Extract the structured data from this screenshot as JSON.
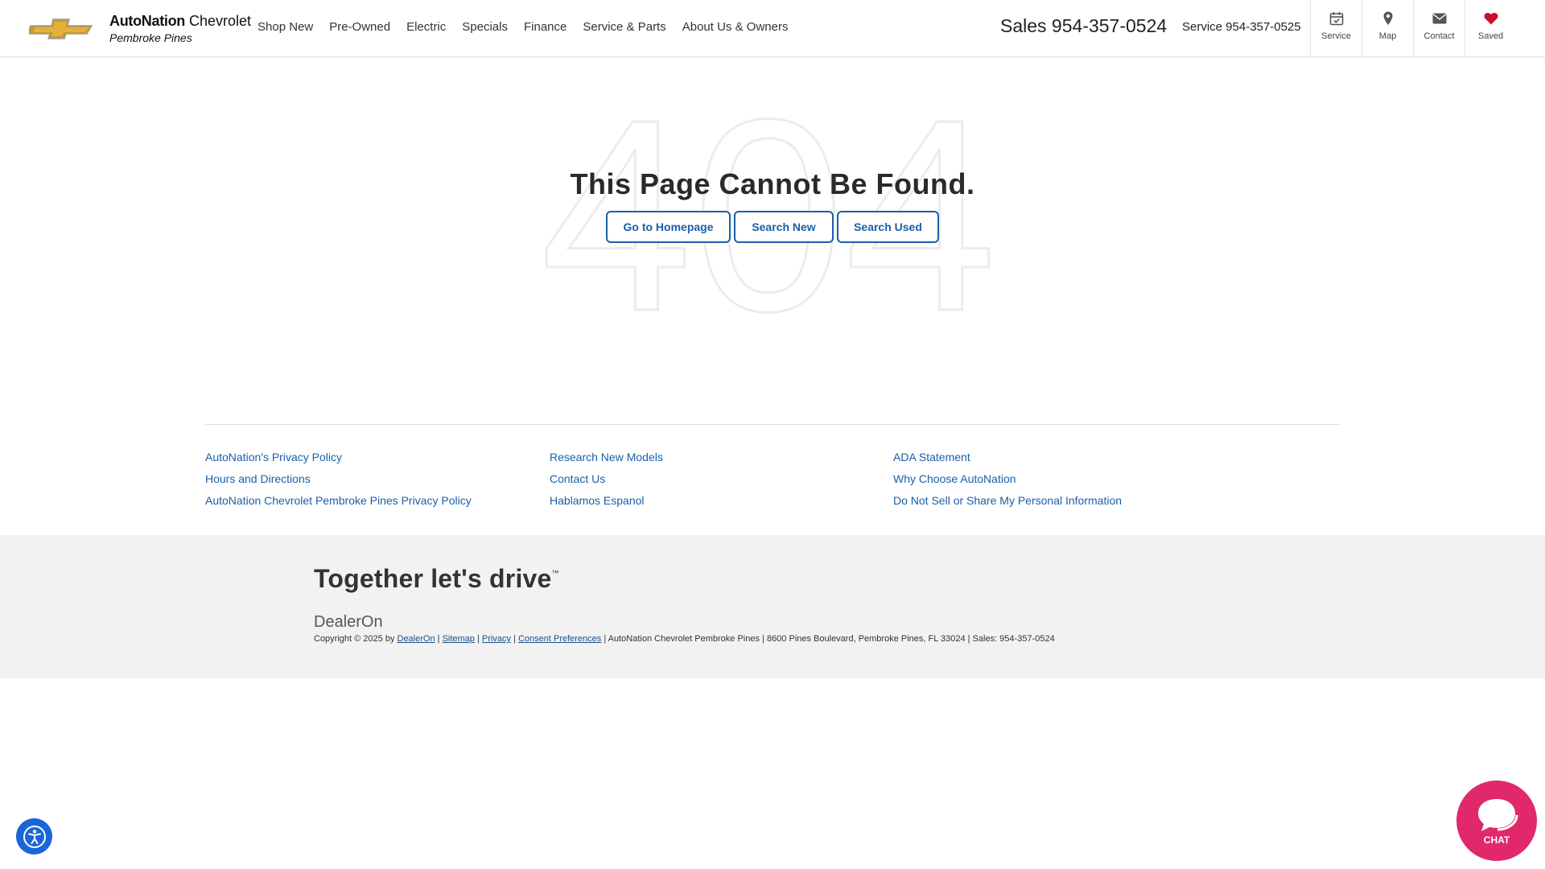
{
  "header": {
    "brand_name_bold": "AutoNation",
    "brand_name_rest": " Chevrolet",
    "brand_location": "Pembroke Pines",
    "nav": [
      "Shop New",
      "Pre-Owned",
      "Electric",
      "Specials",
      "Finance",
      "Service & Parts",
      "About Us & Owners"
    ],
    "sales_phone": "Sales 954-357-0524",
    "service_phone": "Service 954-357-0525",
    "icons": [
      {
        "label": "Service",
        "icon": "calendar-check-icon"
      },
      {
        "label": "Map",
        "icon": "map-pin-icon"
      },
      {
        "label": "Contact",
        "icon": "envelope-icon"
      },
      {
        "label": "Saved",
        "icon": "heart-icon"
      }
    ]
  },
  "main": {
    "bg_number": "404",
    "title": "This Page Cannot Be Found.",
    "buttons": [
      "Go to Homepage",
      "Search New",
      "Search Used"
    ]
  },
  "footer": {
    "col1": [
      "AutoNation's Privacy Policy",
      "Hours and Directions",
      "AutoNation Chevrolet Pembroke Pines Privacy Policy"
    ],
    "col2": [
      "Research New Models",
      "Contact Us",
      "Hablamos Espanol"
    ],
    "col3": [
      "ADA Statement",
      "Why Choose AutoNation",
      "Do Not Sell or Share My Personal Information"
    ],
    "tagline": "Together let's drive",
    "tagline_mark": "™",
    "dealeron_logo": "DealerOn",
    "copyright_prefix": "Copyright © 2025 by ",
    "copyright_links": [
      "DealerOn",
      "Sitemap",
      "Privacy",
      "Consent Preferences"
    ],
    "copyright_suffix": " | AutoNation Chevrolet Pembroke Pines | 8600 Pines Boulevard, Pembroke Pines, FL 33024 | Sales: 954-357-0524"
  },
  "floating": {
    "chat_label": "CHAT"
  },
  "colors": {
    "link_blue": "#1a5fa8",
    "chat_pink": "#e0286b",
    "accessibility_blue": "#1a66d9",
    "band_gray": "#f2f2f2"
  }
}
